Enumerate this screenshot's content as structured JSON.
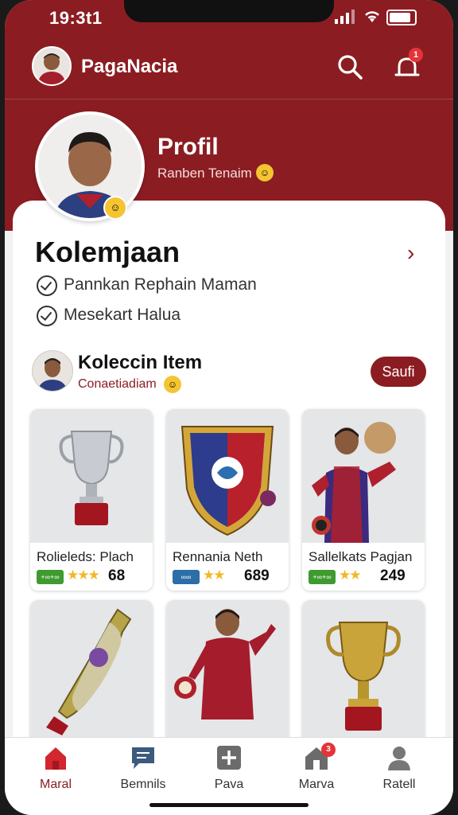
{
  "status_bar": {
    "time": "19:3t1"
  },
  "app": {
    "title": "PagaNacia"
  },
  "header": {
    "alert_count": "1"
  },
  "profile": {
    "title": "Profil",
    "subtitle": "Ranben Tenaim"
  },
  "section": {
    "title": "Kolemjaan",
    "checks": [
      "Pannkan Rephain Maman",
      "Mesekart Halua"
    ]
  },
  "collection": {
    "title": "Koleccin Item",
    "subtitle": "Conaetiadiam",
    "button": "Saufi",
    "items": [
      {
        "name": "Rolieleds: Plach",
        "tag": "+∞+∞",
        "tag_color": "#3f9a2f",
        "score": "68",
        "stars": "★★★"
      },
      {
        "name": "Rennania Neth",
        "tag": "∞∞",
        "tag_color": "#2b6ea8",
        "score": "689",
        "stars": "★★"
      },
      {
        "name": "Sallelkats Pagjan",
        "tag": "+∞+∞",
        "tag_color": "#3f9a2f",
        "score": "249",
        "stars": "★★"
      }
    ]
  },
  "nav": {
    "items": [
      {
        "label": "Maral",
        "icon": "home-icon"
      },
      {
        "label": "Bemnils",
        "icon": "chat-icon"
      },
      {
        "label": "Pava",
        "icon": "add-icon"
      },
      {
        "label": "Marva",
        "icon": "house-notification-icon"
      },
      {
        "label": "Ratell",
        "icon": "user-icon"
      }
    ],
    "notification_count": "3"
  },
  "colors": {
    "primary": "#8b1d22",
    "accent": "#f2b82a",
    "background": "#f2f2f2"
  }
}
